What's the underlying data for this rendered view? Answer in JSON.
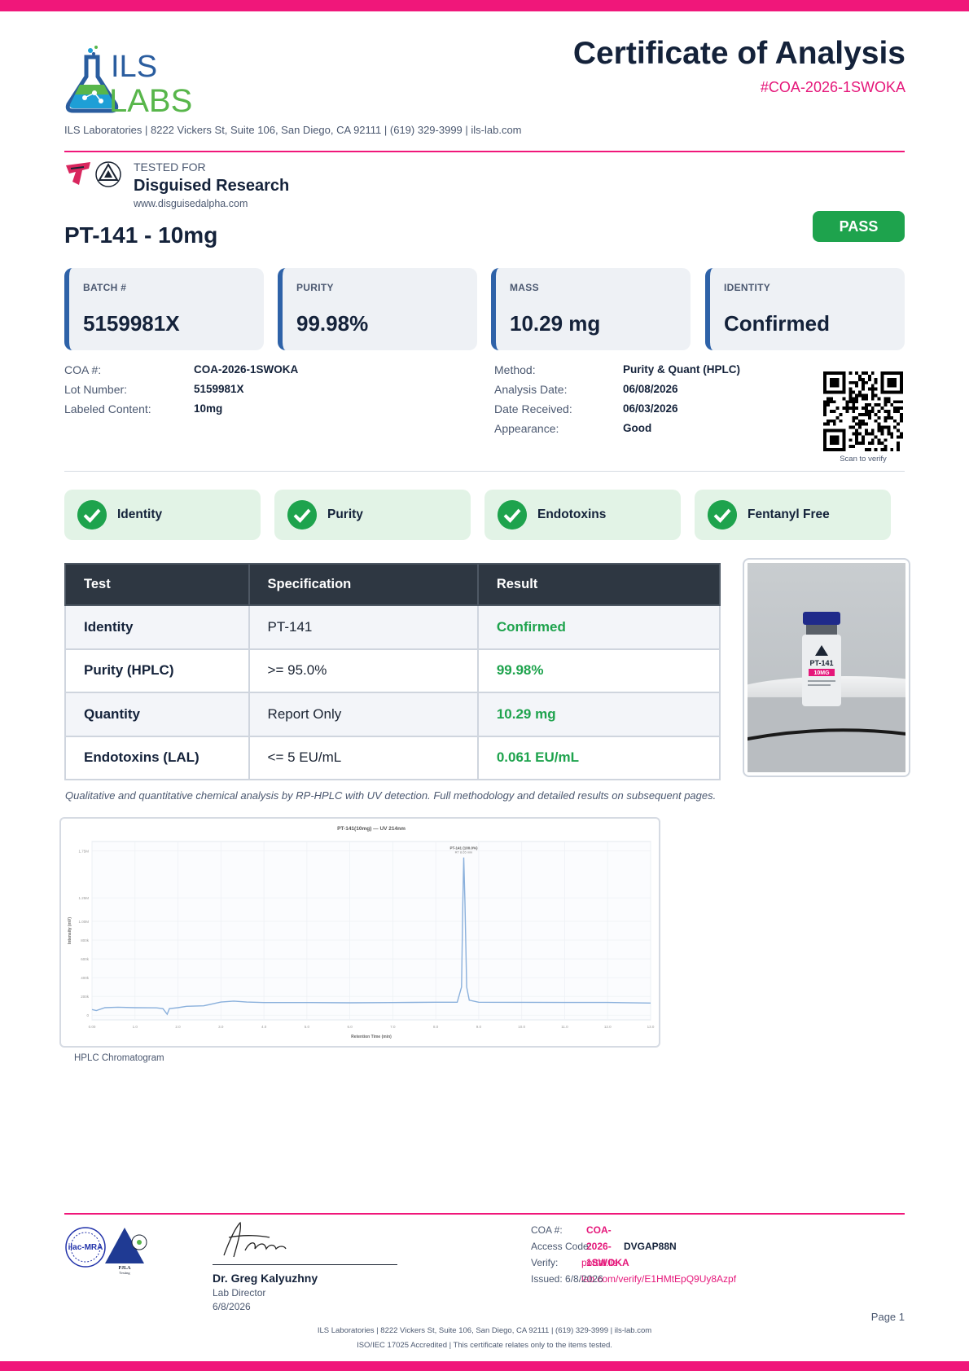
{
  "header": {
    "logo": {
      "text_top": "ILS",
      "text_bottom": "LABS",
      "icon": "flask-logo-icon"
    },
    "title": "Certificate of Analysis",
    "coa_id": "#COA-2026-1SWOKA",
    "address": "ILS Laboratories  |  8222 Vickers St, Suite 106, San Diego, CA 92111  |  (619) 329-3999  |  ils-lab.com"
  },
  "client": {
    "tested_for_label": "TESTED FOR",
    "name": "Disguised Research",
    "url": "www.disguisedalpha.com",
    "icons": [
      "client-logo-icon",
      "alpha-triangle-icon"
    ]
  },
  "product": {
    "name": "PT-141 - 10mg",
    "status": "PASS"
  },
  "summary_cards": [
    {
      "label": "BATCH #",
      "value": "5159981X"
    },
    {
      "label": "PURITY",
      "value": "99.98%"
    },
    {
      "label": "MASS",
      "value": "10.29 mg"
    },
    {
      "label": "IDENTITY",
      "value": "Confirmed"
    }
  ],
  "details_left": [
    {
      "key": "COA #:",
      "value": "COA-2026-1SWOKA"
    },
    {
      "key": "Lot Number:",
      "value": "5159981X"
    },
    {
      "key": "Labeled Content:",
      "value": "10mg"
    }
  ],
  "details_right": [
    {
      "key": "Method:",
      "value": "Purity & Quant (HPLC)"
    },
    {
      "key": "Analysis Date:",
      "value": "06/08/2026"
    },
    {
      "key": "Date Received:",
      "value": "06/03/2026"
    },
    {
      "key": "Appearance:",
      "value": "Good"
    }
  ],
  "qr": {
    "caption": "Scan to verify",
    "icon": "qr-code-icon"
  },
  "badges": [
    {
      "label": "Identity",
      "icon": "check-circle-icon"
    },
    {
      "label": "Purity",
      "icon": "check-circle-icon"
    },
    {
      "label": "Endotoxins",
      "icon": "check-circle-icon"
    },
    {
      "label": "Fentanyl Free",
      "icon": "check-circle-icon"
    }
  ],
  "results_table": {
    "headers": [
      "Test",
      "Specification",
      "Result"
    ],
    "rows": [
      {
        "test": "Identity",
        "spec": "PT-141",
        "result": "Confirmed"
      },
      {
        "test": "Purity (HPLC)",
        "spec": ">= 95.0%",
        "result": "99.98%"
      },
      {
        "test": "Quantity",
        "spec": "Report Only",
        "result": "10.29 mg"
      },
      {
        "test": "Endotoxins (LAL)",
        "spec": "<= 5 EU/mL",
        "result": "0.061 EU/mL"
      }
    ]
  },
  "product_photo": {
    "vial_label": "PT-141",
    "vial_dose": "10MG",
    "brand": "ALPHA"
  },
  "method_note": "Qualitative and quantitative chemical analysis by RP-HPLC with UV detection. Full methodology and detailed results on subsequent pages.",
  "chromatogram": {
    "caption": "HPLC Chromatogram",
    "chart_data": {
      "type": "line",
      "title": "PT-141(10mg) — UV 214nm",
      "xlabel": "Retention Time (min)",
      "ylabel": "Intensity (mV)",
      "xlim": [
        0,
        13
      ],
      "ylim": [
        -50,
        1850
      ],
      "x_ticks": [
        "0.00",
        "1.0",
        "2.0",
        "3.0",
        "4.0",
        "5.0",
        "6.0",
        "7.0",
        "8.0",
        "9.0",
        "10.0",
        "11.0",
        "12.0",
        "13.0"
      ],
      "y_ticks": [
        "0",
        "200k",
        "400k",
        "600k",
        "800k",
        "1.00M",
        "1.25M",
        "1.75M"
      ],
      "peak_label": "PT-141 (100.0%)",
      "peak_sublabel": "RT 8.65 min",
      "grid": true,
      "series": [
        {
          "color": "#8ab0dc",
          "points": [
            [
              0,
              60
            ],
            [
              0.1,
              50
            ],
            [
              0.3,
              80
            ],
            [
              0.6,
              85
            ],
            [
              1.0,
              80
            ],
            [
              1.5,
              78
            ],
            [
              1.65,
              70
            ],
            [
              1.75,
              10
            ],
            [
              1.8,
              70
            ],
            [
              2.0,
              80
            ],
            [
              2.2,
              95
            ],
            [
              2.6,
              100
            ],
            [
              3.0,
              140
            ],
            [
              3.3,
              150
            ],
            [
              3.6,
              140
            ],
            [
              4.0,
              135
            ],
            [
              5.0,
              135
            ],
            [
              6.0,
              132
            ],
            [
              7.0,
              135
            ],
            [
              8.0,
              138
            ],
            [
              8.5,
              138
            ],
            [
              8.6,
              300
            ],
            [
              8.63,
              1200
            ],
            [
              8.65,
              1680
            ],
            [
              8.68,
              1200
            ],
            [
              8.72,
              300
            ],
            [
              8.78,
              160
            ],
            [
              9.0,
              138
            ],
            [
              10.0,
              137
            ],
            [
              11.0,
              136
            ],
            [
              12.0,
              136
            ],
            [
              13.0,
              130
            ]
          ]
        }
      ]
    }
  },
  "footer": {
    "accreditation_icons": [
      "ilac-mra-seal-icon",
      "pjla-testing-seal-icon"
    ],
    "signer_name": "Dr. Greg Kalyuzhny",
    "signer_role": "Lab Director",
    "sign_date": "6/8/2026",
    "coa_label": "COA #:",
    "coa_value": "COA-2026-1SWOKA",
    "access_label": "Access Code:",
    "access_value": "DVGAP88N",
    "verify_label": "Verify:",
    "verify_url": "portal.ils-lab.com/verify/E1HMtEpQ9Uy8Azpf",
    "issued": "Issued: 6/8/2026",
    "page": "Page 1",
    "address": "ILS Laboratories  |  8222 Vickers St, Suite 106, San Diego, CA 92111  |  (619) 329-3999  |  ils-lab.com",
    "iso": "ISO/IEC 17025 Accredited  |  This certificate relates only to the items tested."
  },
  "colors": {
    "accent": "#f0177a",
    "pass_green": "#1ea34d",
    "navy": "#14223a",
    "card_stripe": "#2e62a8"
  }
}
